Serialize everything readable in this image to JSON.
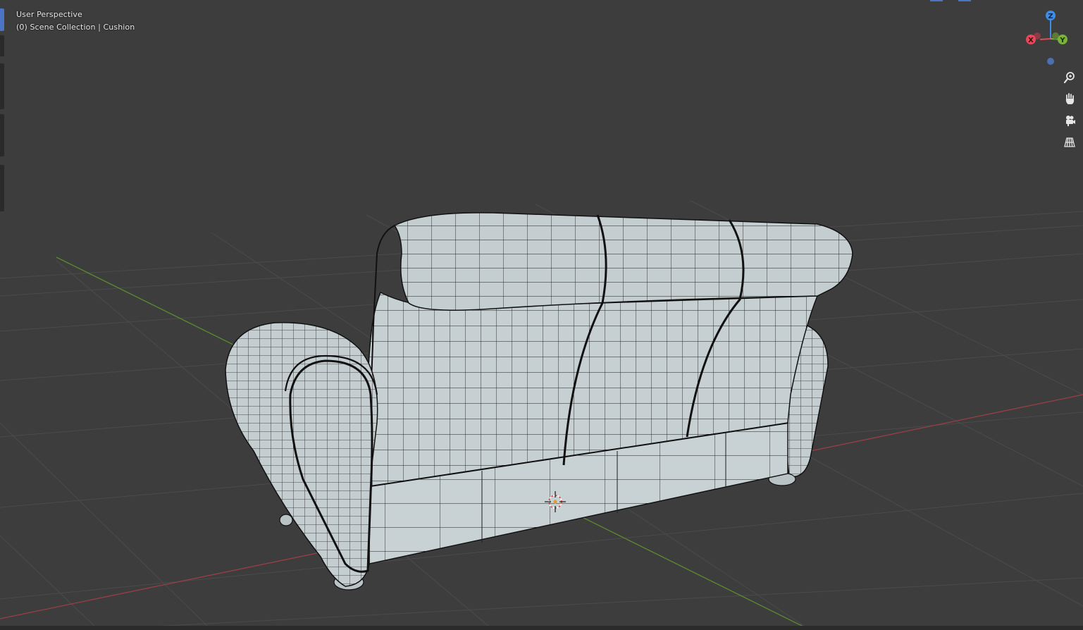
{
  "viewport": {
    "view_name": "User Perspective",
    "collection_line": "(0) Scene Collection | Cushion"
  },
  "gizmo": {
    "axis_z": "Z",
    "axis_y": "Y",
    "axis_x": "X",
    "colors": {
      "x": "#e5495a",
      "y": "#7ab339",
      "z": "#3f8de6",
      "neg": "#4d6fb0"
    }
  },
  "nav_tools": [
    {
      "icon": "zoom-icon"
    },
    {
      "icon": "hand-pan-icon"
    },
    {
      "icon": "camera-view-icon"
    },
    {
      "icon": "grid-perspective-icon"
    }
  ],
  "colors": {
    "background": "#3d3d3d",
    "grid": "#4a4a4a",
    "x_axis": "#9a3f45",
    "y_axis": "#5c8a2e",
    "mesh_fill": "#c5cfd1",
    "mesh_wire": "#1c1c1c",
    "accent": "#4b74c4"
  }
}
